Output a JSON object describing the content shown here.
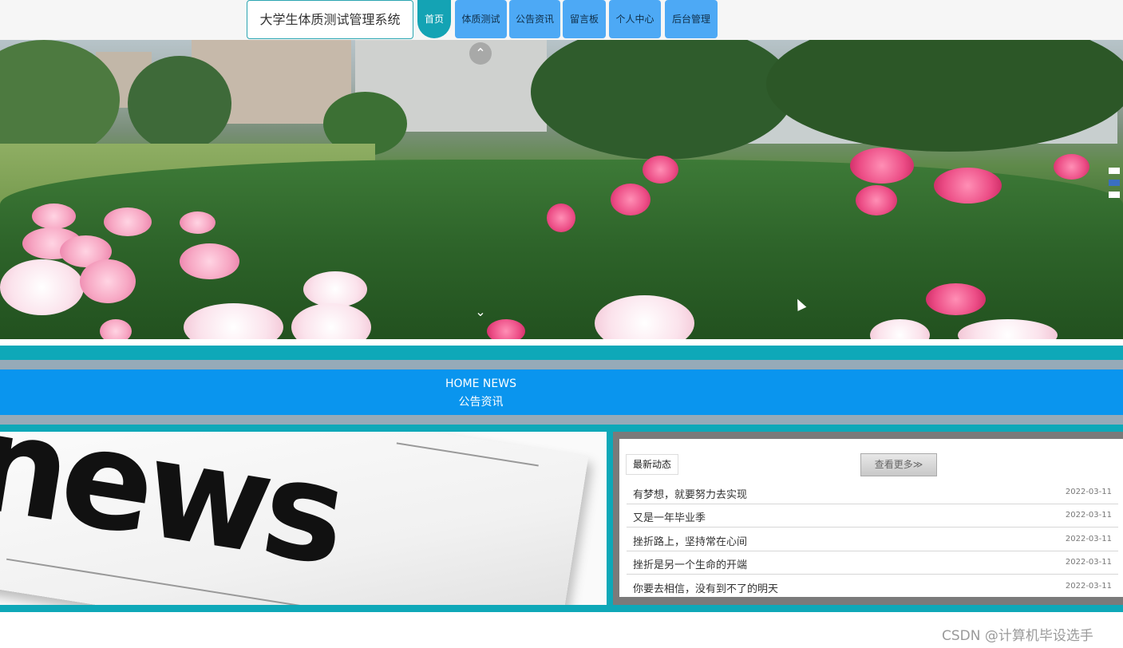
{
  "header": {
    "site_title": "大学生体质测试管理系统",
    "nav": [
      {
        "label": "首页",
        "active": true
      },
      {
        "label": "体质测试",
        "active": false
      },
      {
        "label": "公告资讯",
        "active": false
      },
      {
        "label": "留言板",
        "active": false
      },
      {
        "label": "个人中心",
        "active": false
      },
      {
        "label": "后台管理",
        "active": false
      }
    ]
  },
  "banner": {
    "prev_icon": "chevron-up-icon",
    "next_icon": "chevron-down-icon",
    "slides": 3,
    "active_slide": 2
  },
  "section": {
    "title_en": "HOME NEWS",
    "title_cn": "公告资讯"
  },
  "news": {
    "tab_label": "最新动态",
    "more_label": "查看更多≫",
    "items": [
      {
        "title": "有梦想，就要努力去实现",
        "date": "2022-03-11"
      },
      {
        "title": "又是一年毕业季",
        "date": "2022-03-11"
      },
      {
        "title": "挫折路上，坚持常在心间",
        "date": "2022-03-11"
      },
      {
        "title": "挫折是另一个生命的开端",
        "date": "2022-03-11"
      },
      {
        "title": "你要去相信，没有到不了的明天",
        "date": "2022-03-11"
      }
    ],
    "image_headline": "news"
  },
  "watermark": "CSDN @计算机毕设选手",
  "colors": {
    "teal": "#0ea8b8",
    "nav_blue": "#4da9f5",
    "band_blue": "#0a95ee",
    "band_grey": "#96aab8"
  }
}
